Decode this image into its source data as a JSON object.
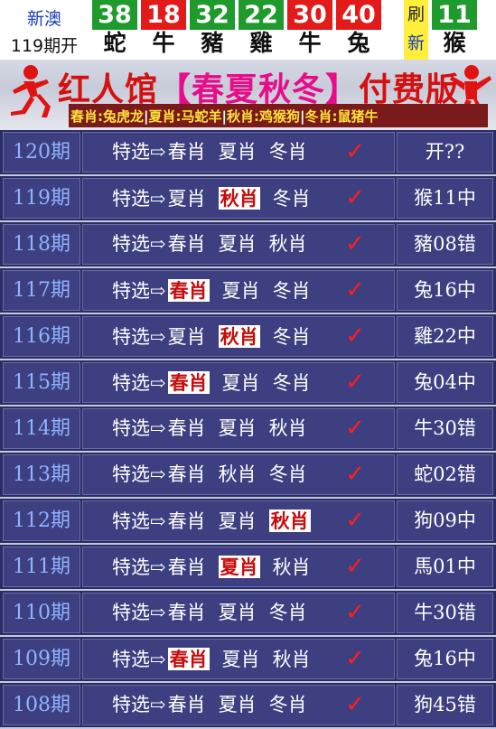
{
  "top": {
    "lottery_name": "新澳",
    "period_label": "119期开",
    "balls": [
      {
        "num": "38",
        "zodiac": "蛇",
        "color": "green"
      },
      {
        "num": "18",
        "zodiac": "牛",
        "color": "red"
      },
      {
        "num": "32",
        "zodiac": "豬",
        "color": "green"
      },
      {
        "num": "22",
        "zodiac": "雞",
        "color": "green"
      },
      {
        "num": "30",
        "zodiac": "牛",
        "color": "red"
      },
      {
        "num": "40",
        "zodiac": "兔",
        "color": "red"
      }
    ],
    "refresh_top": "刷",
    "refresh_bottom": "新",
    "special": {
      "num": "11",
      "zodiac": "猴",
      "color": "green"
    }
  },
  "banner": {
    "title_a": "红人馆",
    "title_b": "【春夏秋冬】",
    "title_c": "付费版",
    "seasons": [
      "春肖:兔虎龙",
      "夏肖:马蛇羊",
      "秋肖:鸡猴狗",
      "冬肖:鼠猪牛"
    ]
  },
  "colors": {
    "green": "#1f9b2e",
    "red": "#e21a1a",
    "refresh": "#ffef3a"
  },
  "rows": [
    {
      "period": "120期",
      "lead": "特选⇨",
      "picks": [
        "春肖",
        "夏肖",
        "冬肖"
      ],
      "hit": -1,
      "result": "开??"
    },
    {
      "period": "119期",
      "lead": "特选⇨",
      "picks": [
        "夏肖",
        "秋肖",
        "冬肖"
      ],
      "hit": 1,
      "result": "猴11中"
    },
    {
      "period": "118期",
      "lead": "特选⇨",
      "picks": [
        "春肖",
        "夏肖",
        "秋肖"
      ],
      "hit": -1,
      "result": "豬08错"
    },
    {
      "period": "117期",
      "lead": "特选⇨",
      "picks": [
        "春肖",
        "夏肖",
        "冬肖"
      ],
      "hit": 0,
      "result": "兔16中"
    },
    {
      "period": "116期",
      "lead": "特选⇨",
      "picks": [
        "夏肖",
        "秋肖",
        "冬肖"
      ],
      "hit": 1,
      "result": "雞22中"
    },
    {
      "period": "115期",
      "lead": "特选⇨",
      "picks": [
        "春肖",
        "夏肖",
        "冬肖"
      ],
      "hit": 0,
      "result": "兔04中"
    },
    {
      "period": "114期",
      "lead": "特选⇨",
      "picks": [
        "春肖",
        "夏肖",
        "秋肖"
      ],
      "hit": -1,
      "result": "牛30错"
    },
    {
      "period": "113期",
      "lead": "特选⇨",
      "picks": [
        "春肖",
        "秋肖",
        "冬肖"
      ],
      "hit": -1,
      "result": "蛇02错"
    },
    {
      "period": "112期",
      "lead": "特选⇨",
      "picks": [
        "春肖",
        "夏肖",
        "秋肖"
      ],
      "hit": 2,
      "result": "狗09中"
    },
    {
      "period": "111期",
      "lead": "特选⇨",
      "picks": [
        "春肖",
        "夏肖",
        "秋肖"
      ],
      "hit": 1,
      "result": "馬01中"
    },
    {
      "period": "110期",
      "lead": "特选⇨",
      "picks": [
        "春肖",
        "夏肖",
        "冬肖"
      ],
      "hit": -1,
      "result": "牛30错"
    },
    {
      "period": "109期",
      "lead": "特选⇨",
      "picks": [
        "春肖",
        "夏肖",
        "秋肖"
      ],
      "hit": 0,
      "result": "兔16中"
    },
    {
      "period": "108期",
      "lead": "特选⇨",
      "picks": [
        "春肖",
        "夏肖",
        "冬肖"
      ],
      "hit": -1,
      "result": "狗45错"
    }
  ],
  "check_mark": "✓"
}
